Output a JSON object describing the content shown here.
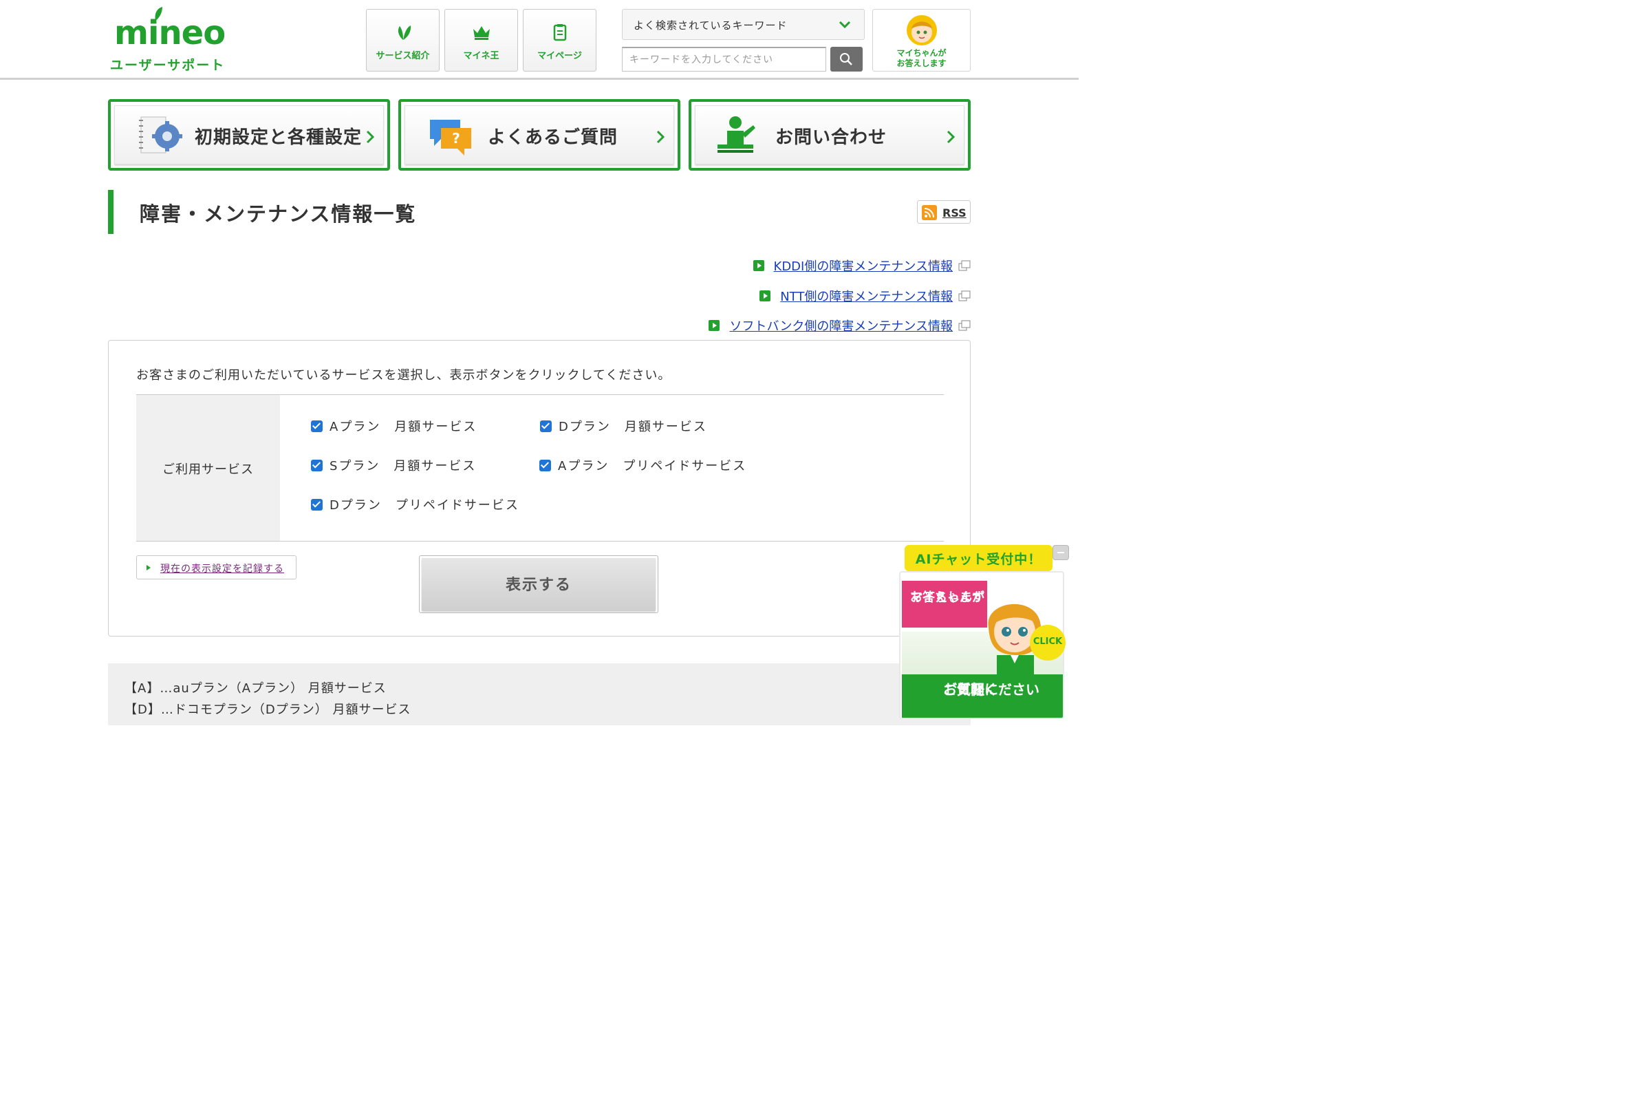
{
  "header": {
    "logo_text": "mineo",
    "logo_sub": "ユーザーサポート",
    "nav": [
      {
        "label": "サービス紹介",
        "icon": "leaf-icon"
      },
      {
        "label": "マイネ王",
        "icon": "crown-icon"
      },
      {
        "label": "マイページ",
        "icon": "clipboard-icon"
      }
    ],
    "keyword_select": "よく検索されているキーワード",
    "search_placeholder": "キーワードを入力してください",
    "mai_label_1": "マイちゃんが",
    "mai_label_2": "お答えします"
  },
  "bignav": [
    {
      "label": "初期設定と各種設定",
      "icon": "gear-notebook-icon"
    },
    {
      "label": "よくあるご質問",
      "icon": "question-bubble-icon"
    },
    {
      "label": "お問い合わせ",
      "icon": "support-person-icon"
    }
  ],
  "page": {
    "title": "障害・メンテナンス情報一覧",
    "rss": "RSS"
  },
  "links": [
    {
      "label": "KDDI側の障害メンテナンス情報"
    },
    {
      "label": "NTT側の障害メンテナンス情報"
    },
    {
      "label": "ソフトバンク側の障害メンテナンス情報"
    }
  ],
  "form": {
    "instruction": "お客さまのご利用いただいているサービスを選択し、表示ボタンをクリックしてください。",
    "service_header": "ご利用サービス",
    "services": [
      {
        "label": "Aプラン　月額サービス",
        "checked": true
      },
      {
        "label": "Dプラン　月額サービス",
        "checked": true
      },
      {
        "label": "Sプラン　月額サービス",
        "checked": true
      },
      {
        "label": "Aプラン　プリペイドサービス",
        "checked": true
      },
      {
        "label": "Dプラン　プリペイドサービス",
        "checked": true
      }
    ],
    "save_link": "現在の表示設定を記録する",
    "show_button": "表示する"
  },
  "legend": [
    "【A】…auプラン（Aプラン） 月額サービス",
    "【D】…ドコモプラン（Dプラン） 月額サービス"
  ],
  "ai_chat": {
    "banner": "AIチャット受付中！",
    "pink_1": "マイちゃんが",
    "pink_2": "お答えします",
    "click": "CLICK",
    "green_1": "お気軽に",
    "green_2": "ご質問ください"
  },
  "colors": {
    "brand_green": "#23a12f",
    "link_blue": "#1a3eb5",
    "checkbox_blue": "#1f74d6",
    "banner_yellow": "#f5e313",
    "pink": "#e43c78"
  }
}
